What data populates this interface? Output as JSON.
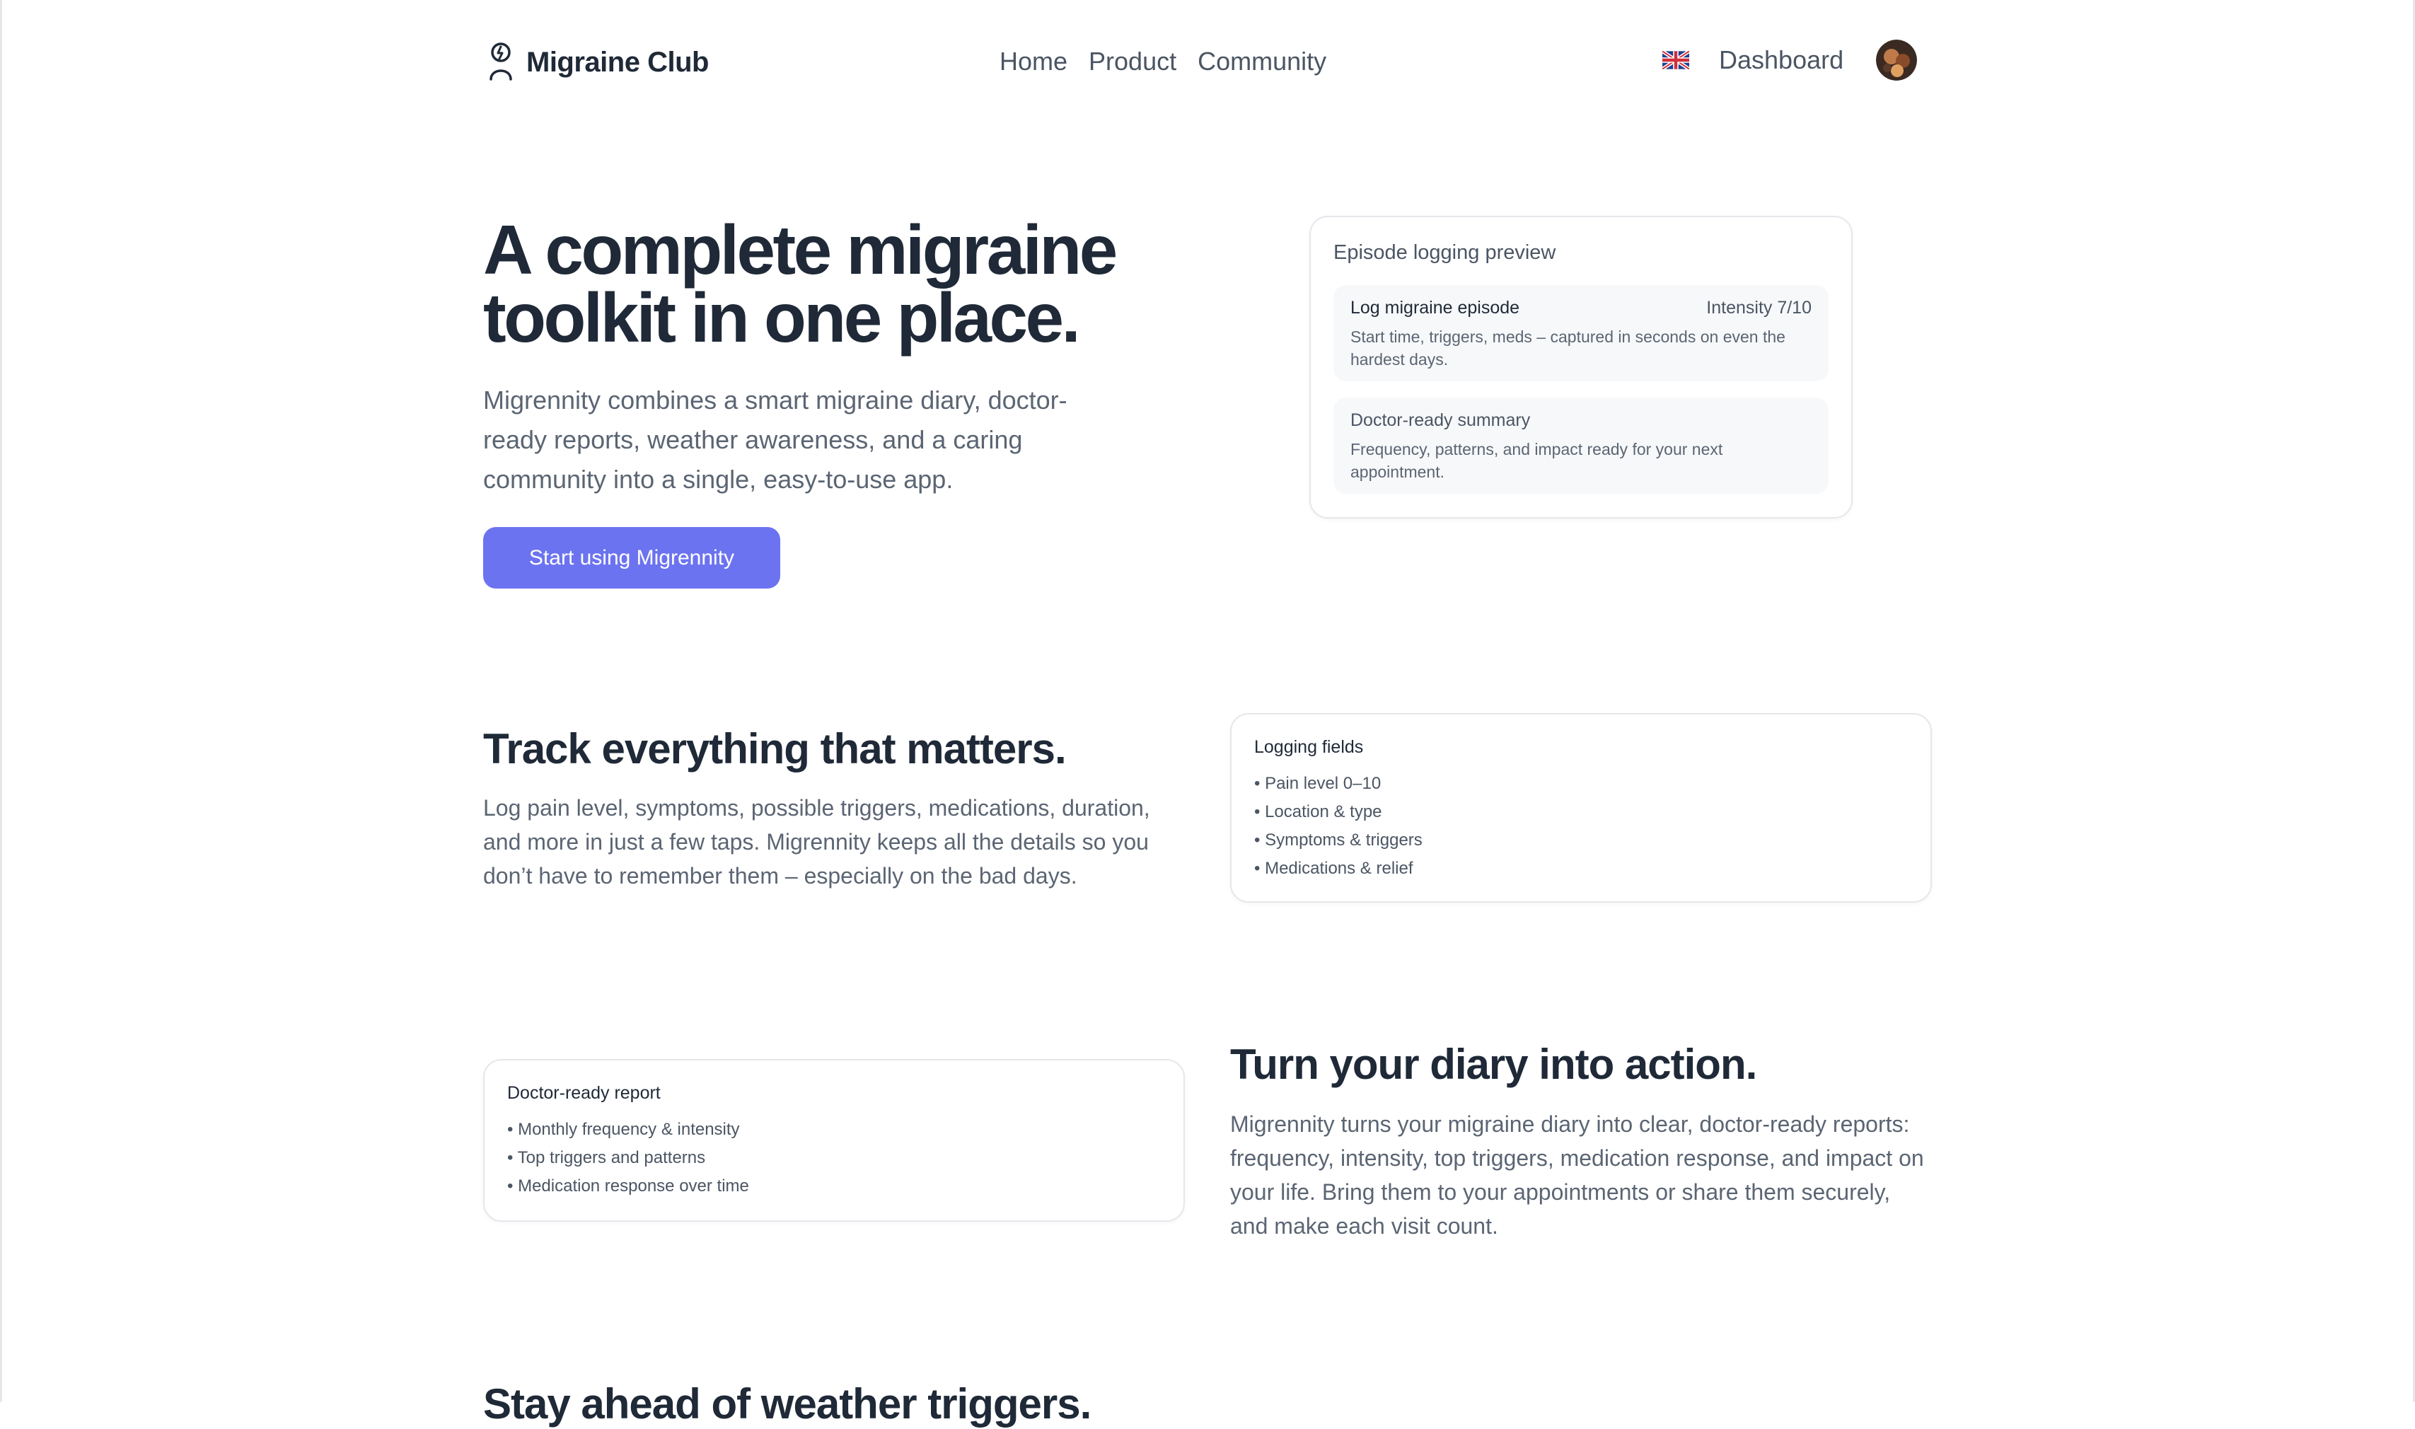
{
  "nav": {
    "brand": "Migraine Club",
    "links": [
      "Home",
      "Product",
      "Community"
    ],
    "dashboard": "Dashboard",
    "language_icon": "uk-flag-icon",
    "avatar_icon": "user-avatar"
  },
  "hero": {
    "title": "A complete migraine toolkit in one place.",
    "description": "Migrennity combines a smart migraine diary, doctor-ready reports, weather awareness, and a caring community into a single, easy-to-use app.",
    "cta": "Start using Migrennity"
  },
  "preview": {
    "title": "Episode logging preview",
    "item1": {
      "title": "Log migraine episode",
      "meta": "Intensity 7/10",
      "text": "Start time, triggers, meds – captured in seconds on even the hardest days."
    },
    "item2": {
      "title": "Doctor-ready summary",
      "text": "Frequency, patterns, and impact ready for your next appointment."
    }
  },
  "track": {
    "title": "Track everything that matters.",
    "text": "Log pain level, symptoms, possible triggers, medications, duration, and more in just a few taps. Migrennity keeps all the details so you don’t have to remember them – especially on the bad days.",
    "card_title": "Logging fields",
    "items": [
      "• Pain level 0–10",
      "• Location & type",
      "• Symptoms & triggers",
      "• Medications & relief"
    ]
  },
  "report": {
    "card_title": "Doctor-ready report",
    "items": [
      "• Monthly frequency & intensity",
      "• Top triggers and patterns",
      "• Medication response over time"
    ],
    "title": "Turn your diary into action.",
    "text": "Migrennity turns your migraine diary into clear, doctor-ready reports: frequency, intensity, top triggers, medication response, and impact on your life. Bring them to your appointments or share them securely, and make each visit count."
  },
  "weather": {
    "title": "Stay ahead of weather triggers."
  },
  "colors": {
    "accent": "#6c73f0",
    "heading": "#1f2937",
    "body": "#5b6573"
  }
}
